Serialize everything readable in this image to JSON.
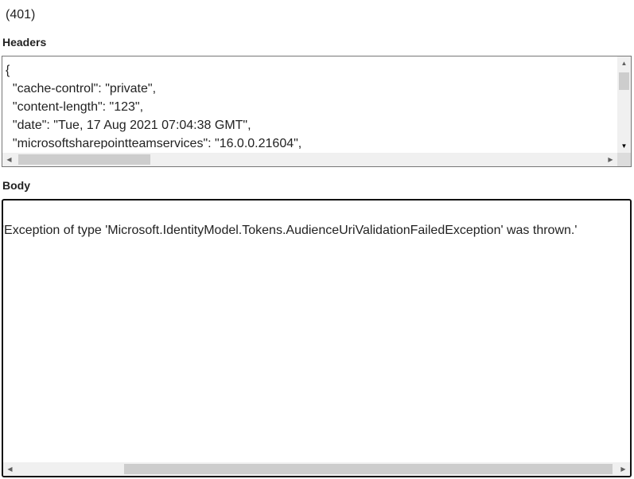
{
  "status": "(401)",
  "headers": {
    "label": "Headers",
    "lines": [
      "{",
      "  \"cache-control\": \"private\",",
      "  \"content-length\": \"123\",",
      "  \"date\": \"Tue, 17 Aug 2021 07:04:38 GMT\",",
      "  \"microsoftsharepointteamservices\": \"16.0.0.21604\","
    ]
  },
  "body": {
    "label": "Body",
    "text": "'Exception of type 'Microsoft.IdentityModel.Tokens.AudienceUriValidationFailedException' was thrown.'"
  },
  "icons": {
    "scroll_up": "▲",
    "scroll_down": "▼",
    "scroll_left": "◀",
    "scroll_right": "▶"
  }
}
